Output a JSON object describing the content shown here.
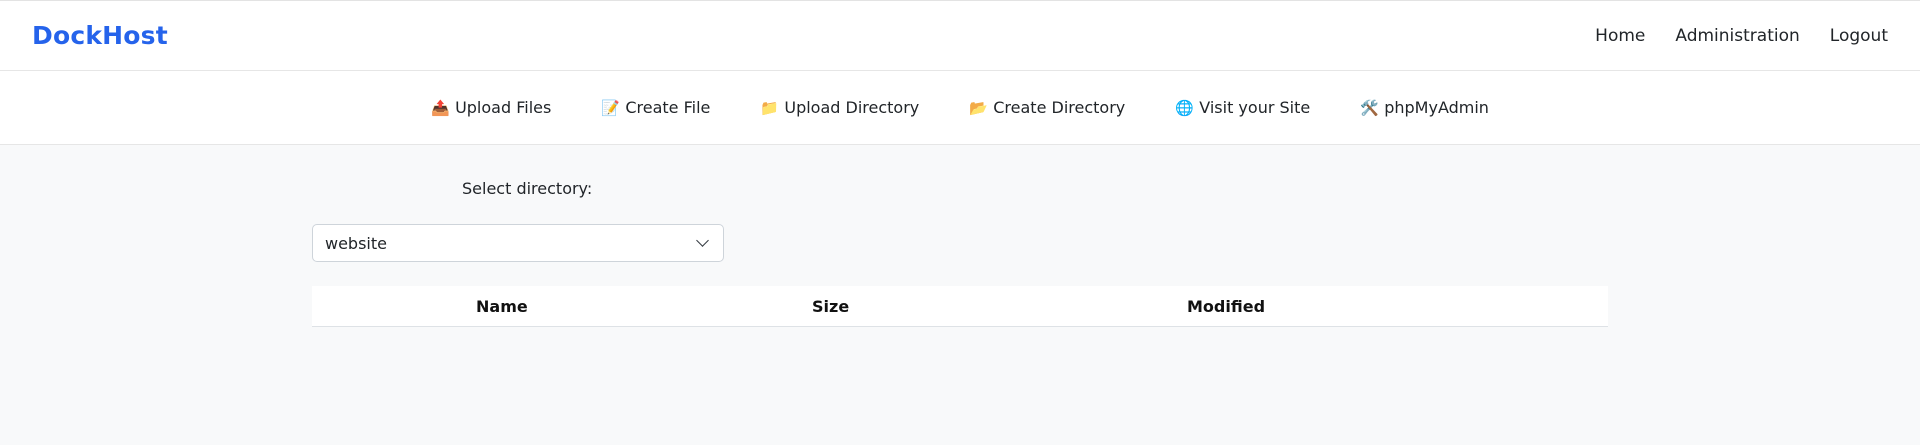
{
  "header": {
    "brand": "DockHost",
    "nav": [
      "Home",
      "Administration",
      "Logout"
    ]
  },
  "toolbar": {
    "items": [
      {
        "icon": "outbox-tray-icon",
        "glyph": "📤",
        "label": "Upload Files"
      },
      {
        "icon": "memo-icon",
        "glyph": "📝",
        "label": "Create File"
      },
      {
        "icon": "folder-icon",
        "glyph": "📁",
        "label": "Upload Directory"
      },
      {
        "icon": "open-folder-icon",
        "glyph": "📂",
        "label": "Create Directory"
      },
      {
        "icon": "globe-icon",
        "glyph": "🌐",
        "label": "Visit your Site"
      },
      {
        "icon": "tools-icon",
        "glyph": "🛠️",
        "label": "phpMyAdmin"
      }
    ]
  },
  "main": {
    "directory_label": "Select directory:",
    "directory_value": "website",
    "table": {
      "columns": [
        "Name",
        "Size",
        "Modified"
      ],
      "rows": []
    }
  },
  "colors": {
    "brand": "#2563eb",
    "background": "#f8f9fa"
  }
}
